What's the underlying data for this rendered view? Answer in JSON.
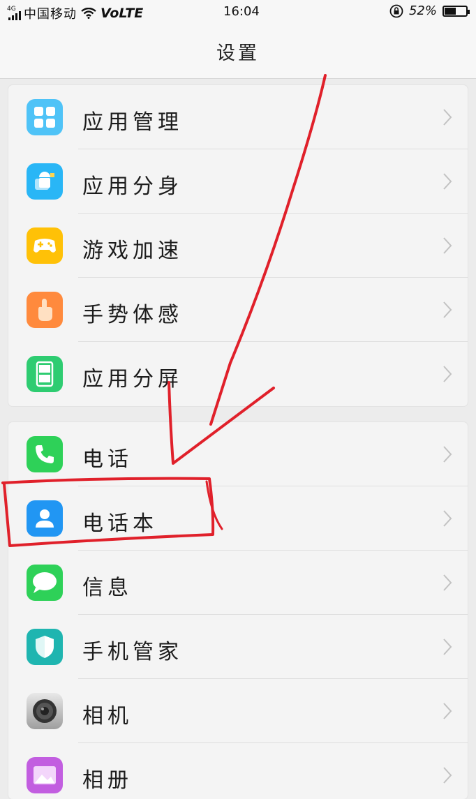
{
  "status_bar": {
    "network_type": "4G",
    "carrier": "中国移动",
    "volte": "VoLTE",
    "time": "16:04",
    "battery_percent": "52%",
    "battery_level": 0.52
  },
  "header": {
    "title": "设置"
  },
  "groups": [
    {
      "items": [
        {
          "label": "应用管理",
          "icon": "app-management-icon",
          "color": "#4fc3f7"
        },
        {
          "label": "应用分身",
          "icon": "app-clone-icon",
          "color": "#29b6f6"
        },
        {
          "label": "游戏加速",
          "icon": "game-acceleration-icon",
          "color": "#ffc107"
        },
        {
          "label": "手势体感",
          "icon": "gesture-icon",
          "color": "#ff8a3d"
        },
        {
          "label": "应用分屏",
          "icon": "split-screen-icon",
          "color": "#2ecc71"
        }
      ]
    },
    {
      "items": [
        {
          "label": "电话",
          "icon": "phone-icon",
          "color": "#2ed158"
        },
        {
          "label": "电话本",
          "icon": "contacts-icon",
          "color": "#2196f3"
        },
        {
          "label": "信息",
          "icon": "messages-icon",
          "color": "#2ed158"
        },
        {
          "label": "手机管家",
          "icon": "phone-manager-icon",
          "color": "#1fb5b0"
        },
        {
          "label": "相机",
          "icon": "camera-icon",
          "color": "#9e9e9e"
        },
        {
          "label": "相册",
          "icon": "gallery-icon",
          "color": "#c25ee0"
        }
      ]
    }
  ],
  "colors": {
    "annotation": "#e0202a"
  }
}
